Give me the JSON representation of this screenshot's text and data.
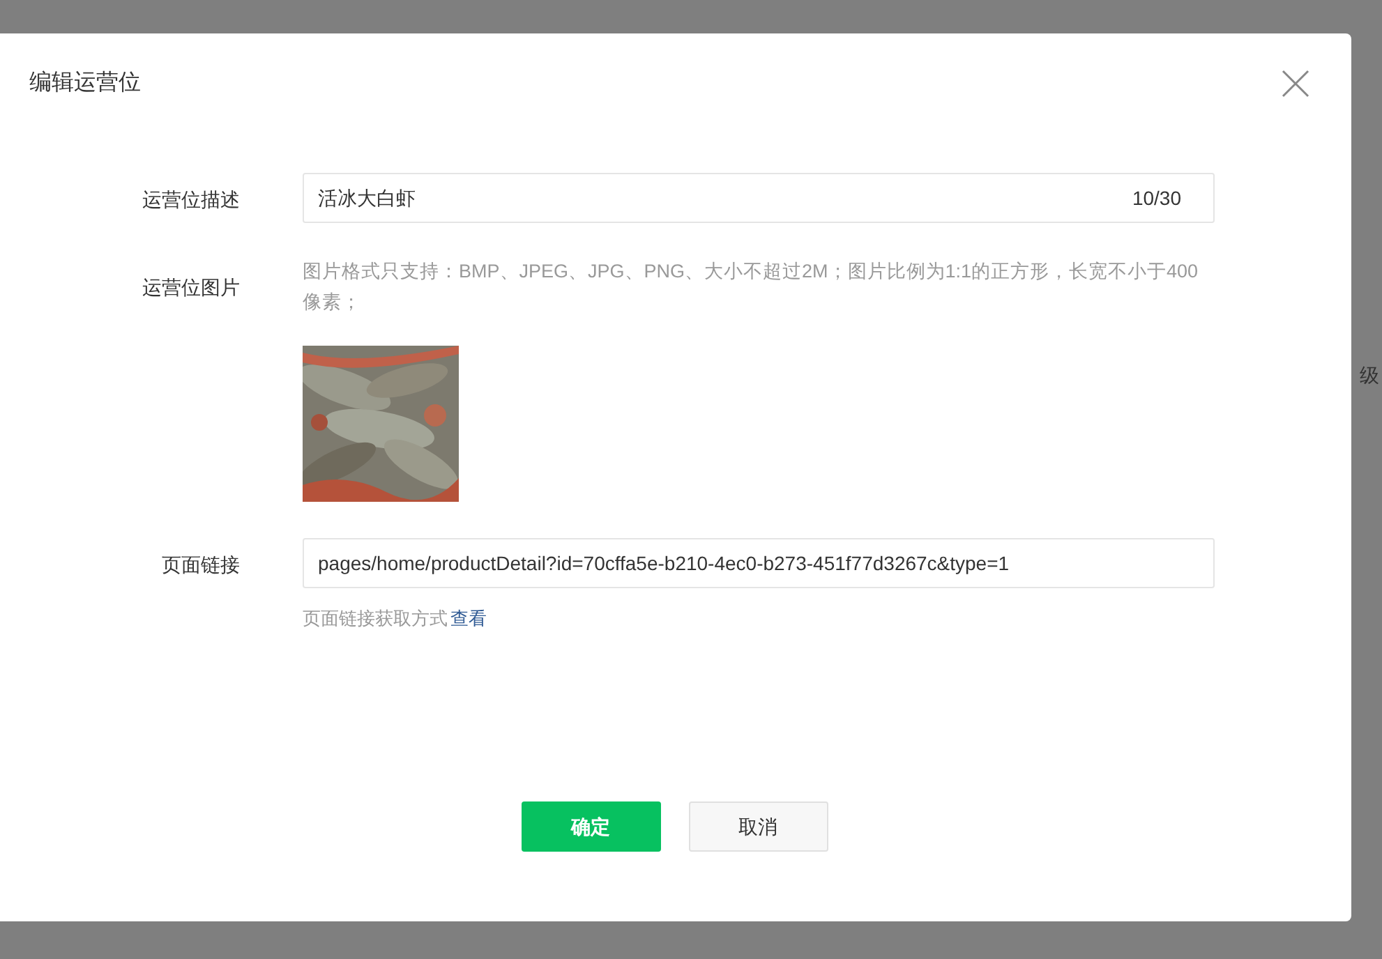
{
  "background": {
    "text_fragment": "级"
  },
  "dialog": {
    "title": "编辑运营位",
    "fields": [
      {
        "kind": "text",
        "label": "运营位描述",
        "value": "活冰大白虾",
        "counter": "10/30"
      },
      {
        "label": "运营位图片",
        "hint": "图片格式只支持：BMP、JPEG、JPG、PNG、大小不超过2M；图片比例为1:1的正方形，长宽不小于400像素；"
      },
      {
        "kind": "link",
        "label": "页面链接",
        "value": "pages/home/productDetail?id=70cffa5e-b210-4ec0-b273-451f77d3267c&type=1",
        "help": "页面链接获取方式",
        "help_link": "查看"
      }
    ],
    "buttons": [
      {
        "label": "确定",
        "kind": "primary"
      },
      {
        "label": "取消",
        "kind": "default"
      }
    ]
  }
}
